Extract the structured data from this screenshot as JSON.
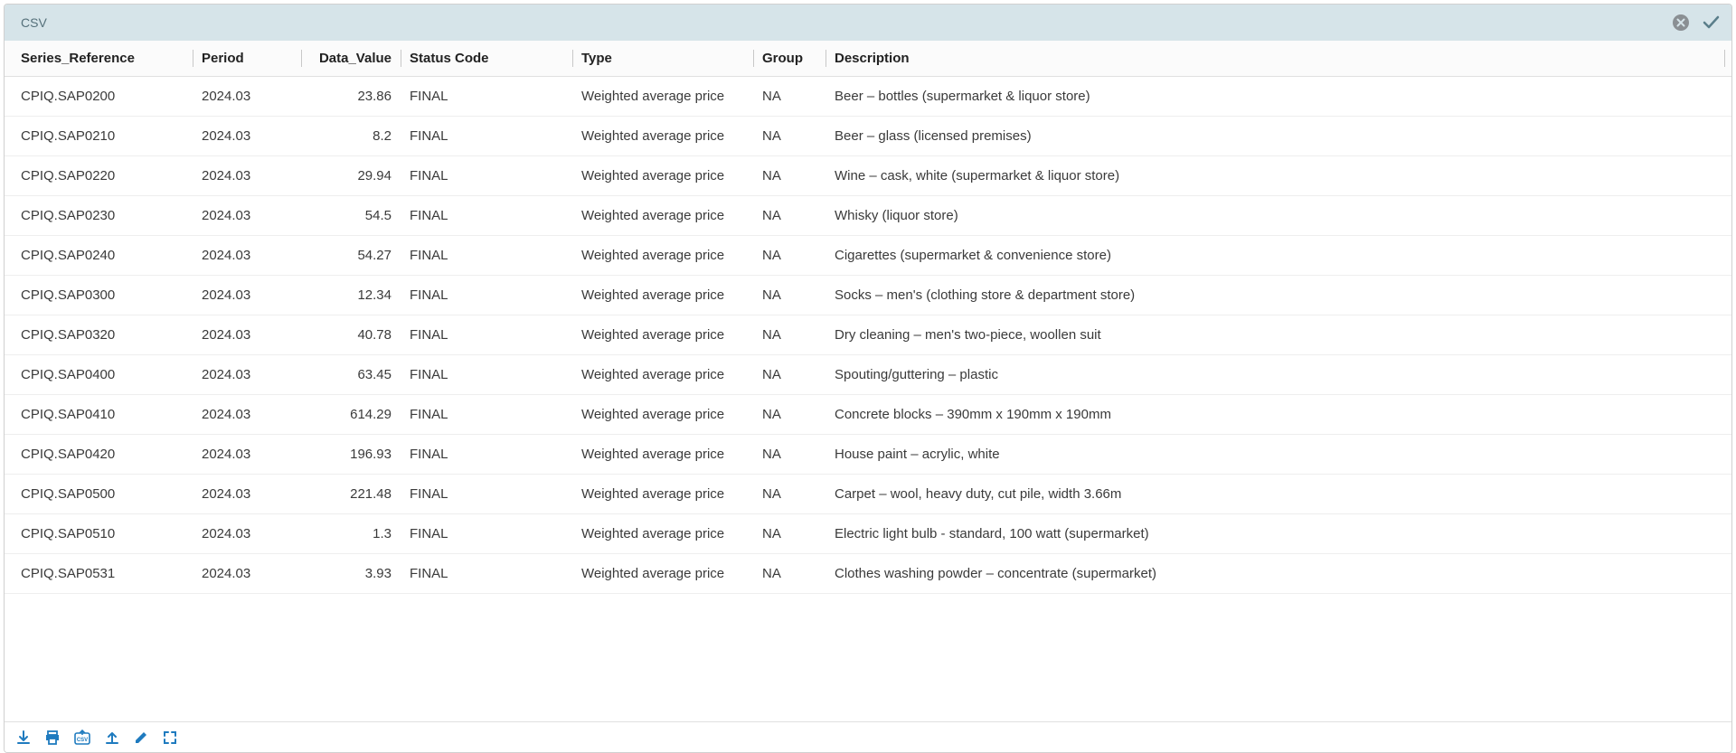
{
  "title": "CSV",
  "columns": [
    "Series_Reference",
    "Period",
    "Data_Value",
    "Status Code",
    "Type",
    "Group",
    "Description"
  ],
  "rows": [
    {
      "ref": "CPIQ.SAP0200",
      "period": "2024.03",
      "value": "23.86",
      "status": "FINAL",
      "type": "Weighted average price",
      "group": "NA",
      "desc": "Beer – bottles (supermarket & liquor store)"
    },
    {
      "ref": "CPIQ.SAP0210",
      "period": "2024.03",
      "value": "8.2",
      "status": "FINAL",
      "type": "Weighted average price",
      "group": "NA",
      "desc": "Beer – glass (licensed premises)"
    },
    {
      "ref": "CPIQ.SAP0220",
      "period": "2024.03",
      "value": "29.94",
      "status": "FINAL",
      "type": "Weighted average price",
      "group": "NA",
      "desc": "Wine – cask, white (supermarket & liquor store)"
    },
    {
      "ref": "CPIQ.SAP0230",
      "period": "2024.03",
      "value": "54.5",
      "status": "FINAL",
      "type": "Weighted average price",
      "group": "NA",
      "desc": "Whisky (liquor store)"
    },
    {
      "ref": "CPIQ.SAP0240",
      "period": "2024.03",
      "value": "54.27",
      "status": "FINAL",
      "type": "Weighted average price",
      "group": "NA",
      "desc": "Cigarettes (supermarket & convenience store)"
    },
    {
      "ref": "CPIQ.SAP0300",
      "period": "2024.03",
      "value": "12.34",
      "status": "FINAL",
      "type": "Weighted average price",
      "group": "NA",
      "desc": "Socks – men's (clothing store & department store)"
    },
    {
      "ref": "CPIQ.SAP0320",
      "period": "2024.03",
      "value": "40.78",
      "status": "FINAL",
      "type": "Weighted average price",
      "group": "NA",
      "desc": "Dry cleaning – men's two-piece, woollen suit"
    },
    {
      "ref": "CPIQ.SAP0400",
      "period": "2024.03",
      "value": "63.45",
      "status": "FINAL",
      "type": "Weighted average price",
      "group": "NA",
      "desc": "Spouting/guttering – plastic"
    },
    {
      "ref": "CPIQ.SAP0410",
      "period": "2024.03",
      "value": "614.29",
      "status": "FINAL",
      "type": "Weighted average price",
      "group": "NA",
      "desc": "Concrete blocks – 390mm x 190mm x 190mm"
    },
    {
      "ref": "CPIQ.SAP0420",
      "period": "2024.03",
      "value": "196.93",
      "status": "FINAL",
      "type": "Weighted average price",
      "group": "NA",
      "desc": "House paint – acrylic, white"
    },
    {
      "ref": "CPIQ.SAP0500",
      "period": "2024.03",
      "value": "221.48",
      "status": "FINAL",
      "type": "Weighted average price",
      "group": "NA",
      "desc": "Carpet – wool, heavy duty, cut pile, width 3.66m"
    },
    {
      "ref": "CPIQ.SAP0510",
      "period": "2024.03",
      "value": "1.3",
      "status": "FINAL",
      "type": "Weighted average price",
      "group": "NA",
      "desc": "Electric light bulb - standard, 100 watt (supermarket)"
    },
    {
      "ref": "CPIQ.SAP0531",
      "period": "2024.03",
      "value": "3.93",
      "status": "FINAL",
      "type": "Weighted average price",
      "group": "NA",
      "desc": "Clothes washing powder – concentrate (supermarket)"
    }
  ]
}
